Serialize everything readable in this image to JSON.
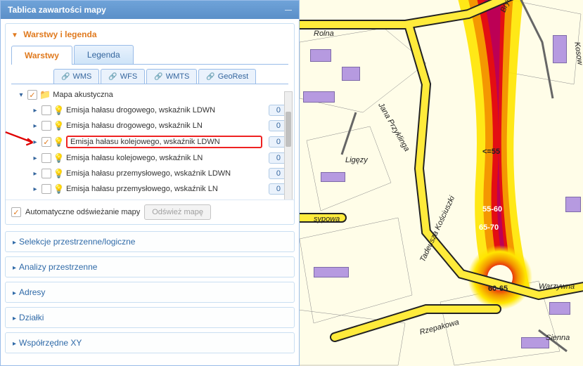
{
  "panel": {
    "title": "Tablica zawartości mapy",
    "sections": {
      "layers": {
        "title": "Warstwy i legenda",
        "tabs": {
          "warstwy": "Warstwy",
          "legenda": "Legenda"
        },
        "services": {
          "wms": "WMS",
          "wfs": "WFS",
          "wmts": "WMTS",
          "georest": "GeoRest"
        },
        "root": "Mapa akustyczna",
        "items": [
          {
            "label": "Emisja hałasu drogowego, wskaźnik LDWN",
            "count": "0",
            "checked": false
          },
          {
            "label": "Emisja hałasu drogowego, wskaźnik LN",
            "count": "0",
            "checked": false
          },
          {
            "label": "Emisja hałasu kolejowego, wskaźnik LDWN",
            "count": "0",
            "checked": true,
            "highlight": true
          },
          {
            "label": "Emisja hałasu kolejowego, wskaźnik LN",
            "count": "0",
            "checked": false
          },
          {
            "label": "Emisja hałasu przemysłowego, wskaźnik LDWN",
            "count": "0",
            "checked": false
          },
          {
            "label": "Emisja hałasu przemysłowego, wskaźnik LN",
            "count": "0",
            "checked": false
          }
        ],
        "auto_refresh_label": "Automatyczne odświeżanie mapy",
        "refresh_btn": "Odśwież mapę"
      },
      "collapsed": [
        "Selekcje przestrzenne/logiczne",
        "Analizy przestrzenne",
        "Adresy",
        "Działki",
        "Współrzędne XY"
      ]
    }
  },
  "map": {
    "streets": {
      "rolna": "Rolna",
      "brync": "Brync",
      "kosow": "Kosow",
      "przyklinga": "Jana Przyklinga",
      "ligezy": "Ligęzy",
      "sypowa": "sypowa",
      "kosciuszki": "Tadeusza Kościuszki",
      "warzywna": "Warzywna",
      "rzepakowa": "Rzepakowa",
      "sienna": "Sienna"
    },
    "noise_labels": {
      "lte55": "<=55",
      "r55_60": "55-60",
      "r65_70": "65-70",
      "r60_65": "60-65"
    }
  }
}
